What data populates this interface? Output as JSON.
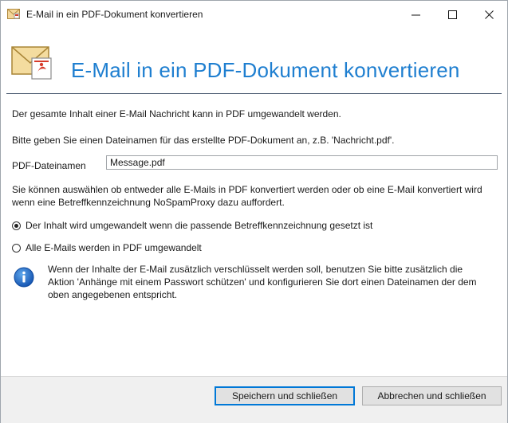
{
  "window": {
    "title": "E-Mail in ein PDF-Dokument konvertieren",
    "minimize_glyph": "—",
    "maximize_glyph": "☐",
    "close_glyph": "✕"
  },
  "header": {
    "title": "E-Mail in ein PDF-Dokument konvertieren",
    "icon": "envelope-pdf-icon",
    "accent_color": "#1f7fd0"
  },
  "content": {
    "intro_line": "Der gesamte Inhalt einer E-Mail Nachricht kann in PDF umgewandelt werden.",
    "filename_hint": "Bitte geben Sie einen Dateinamen für das erstellte PDF-Dokument an, z.B. 'Nachricht.pdf'.",
    "filename_label": "PDF-Dateinamen",
    "filename_value": "Message.pdf",
    "mode_description": "Sie können auswählen ob entweder alle E-Mails in PDF konvertiert werden oder ob eine E-Mail konvertiert wird wenn eine Betreffkennzeichnung NoSpamProxy dazu auffordert.",
    "options": [
      {
        "label": "Der Inhalt wird umgewandelt wenn die passende Betreffkennzeichnung gesetzt ist",
        "selected": true
      },
      {
        "label": "Alle E-Mails werden in PDF umgewandelt",
        "selected": false
      }
    ],
    "info_text": "Wenn der Inhalte der E-Mail zusätzlich verschlüsselt werden soll, benutzen Sie bitte zusätzlich die Aktion 'Anhänge mit einem Passwort schützen' und konfigurieren Sie dort einen Dateinamen der dem oben angegebenen entspricht."
  },
  "footer": {
    "save_label": "Speichern und schließen",
    "cancel_label": "Abbrechen und schließen"
  }
}
